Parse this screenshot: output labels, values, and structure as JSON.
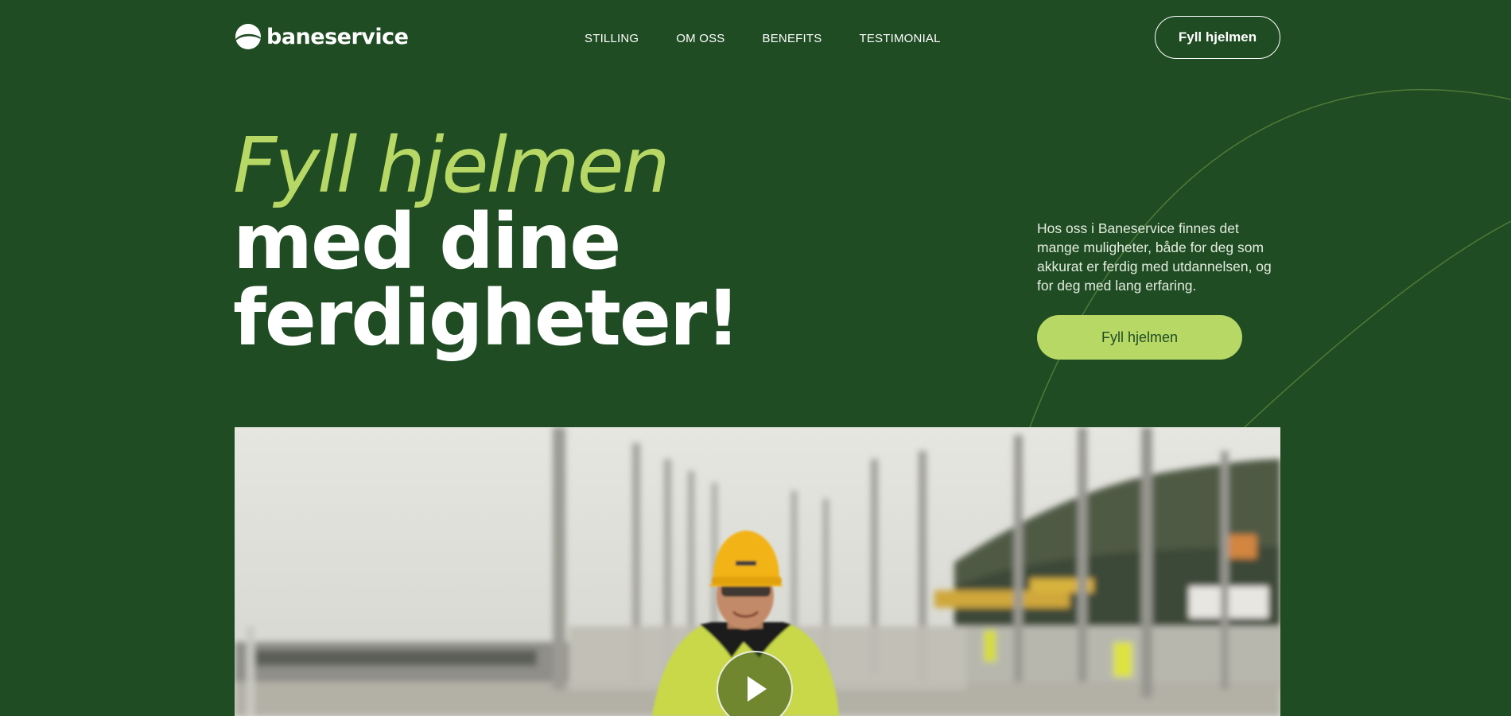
{
  "colors": {
    "background": "#1f4c23",
    "accent": "#b8d866",
    "text": "#ffffff"
  },
  "header": {
    "logo_text": "baneservice",
    "nav": [
      {
        "label": "STILLING"
      },
      {
        "label": "OM OSS"
      },
      {
        "label": "BENEFITS"
      },
      {
        "label": "TESTIMONIAL"
      }
    ],
    "cta_label": "Fyll hjelmen"
  },
  "hero": {
    "title_accent": "Fyll hjelmen",
    "title_line2": "med dine",
    "title_line3": "ferdigheter!",
    "description": "Hos oss i Baneservice finnes det mange muligheter, både for deg som akkurat er ferdig med utdannelsen, og for deg med lang erfaring.",
    "cta_label": "Fyll hjelmen"
  },
  "media": {
    "play_icon": "play-icon"
  }
}
